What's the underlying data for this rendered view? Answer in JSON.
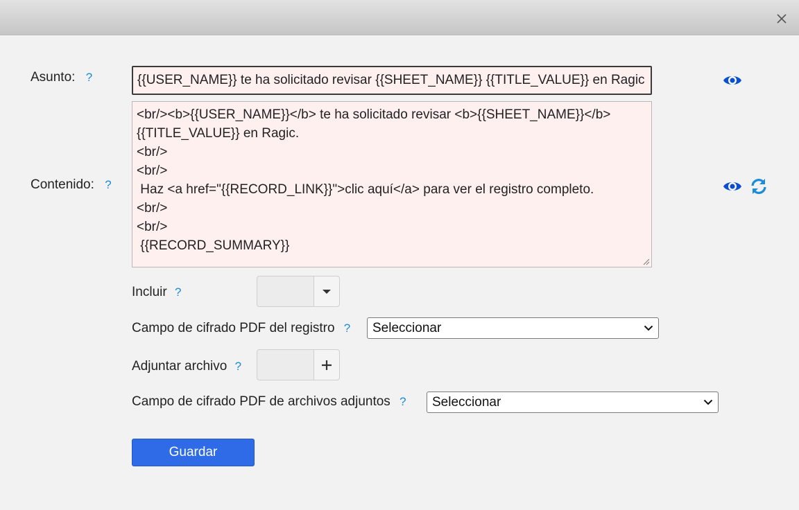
{
  "header": {
    "close_icon": "close-icon"
  },
  "subject": {
    "label": "Asunto:",
    "help": "?",
    "value": "{{USER_NAME}} te ha solicitado revisar {{SHEET_NAME}} {{TITLE_VALUE}} en Ragic"
  },
  "content": {
    "label": "Contenido:",
    "help": "?",
    "lines": [
      "<br/><b>{{USER_NAME}}</b> te ha solicitado revisar <b>{{SHEET_NAME}}</b>",
      "{{TITLE_VALUE}} en Ragic.",
      "<br/>",
      "<br/>",
      " Haz <a href=\"{{RECORD_LINK}}\">clic aquí</a> para ver el registro completo.",
      "<br/>",
      "<br/>",
      " {{RECORD_SUMMARY}}"
    ]
  },
  "include": {
    "label": "Incluir",
    "help": "?"
  },
  "pdf_record_field": {
    "label": "Campo de cifrado PDF del registro",
    "help": "?",
    "selected": "Seleccionar"
  },
  "attach": {
    "label": "Adjuntar archivo",
    "help": "?"
  },
  "pdf_attach_field": {
    "label": "Campo de cifrado PDF de archivos adjuntos",
    "help": "?",
    "selected": "Seleccionar"
  },
  "save": {
    "label": "Guardar"
  },
  "colors": {
    "accent": "#2f6be6",
    "icon_blue": "#0a4fcf",
    "help_blue": "#1a8cd8",
    "field_bg": "#fff0f0"
  }
}
